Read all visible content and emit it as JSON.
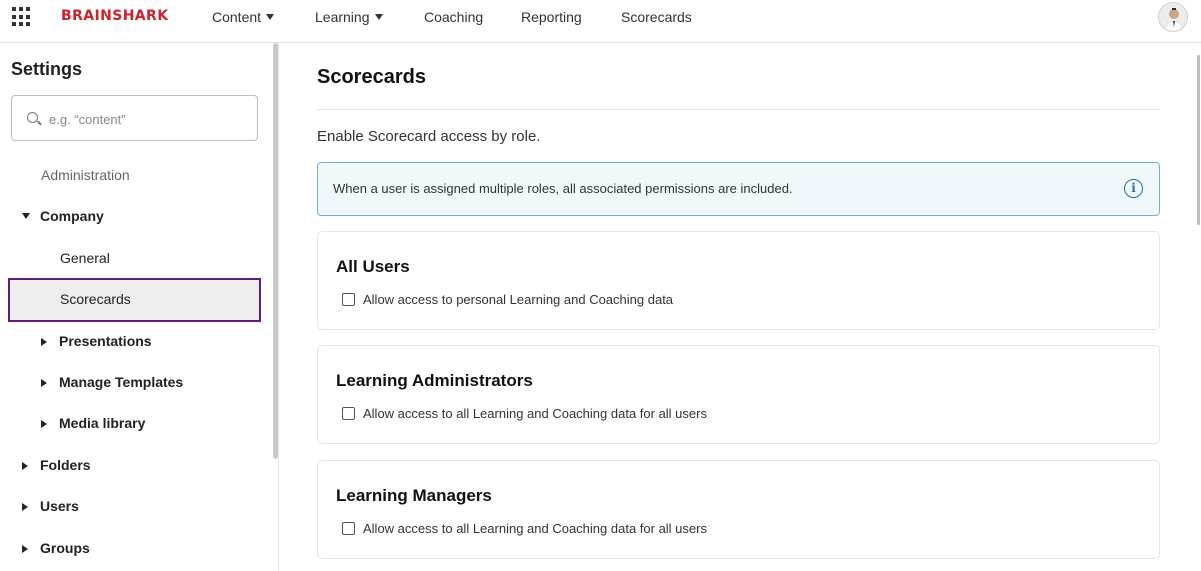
{
  "topbar": {
    "logo": "BRAINSHARK",
    "nav": [
      {
        "label": "Content",
        "dropdown": true
      },
      {
        "label": "Learning",
        "dropdown": true
      },
      {
        "label": "Coaching",
        "dropdown": false
      },
      {
        "label": "Reporting",
        "dropdown": false
      },
      {
        "label": "Scorecards",
        "dropdown": false
      }
    ]
  },
  "sidebar": {
    "title": "Settings",
    "search_placeholder": "e.g. “content”",
    "items": {
      "administration": "Administration",
      "company": "Company",
      "general": "General",
      "scorecards": "Scorecards",
      "presentations": "Presentations",
      "manage_templates": "Manage Templates",
      "media_library": "Media library",
      "folders": "Folders",
      "users": "Users",
      "groups": "Groups"
    }
  },
  "main": {
    "title": "Scorecards",
    "subtitle": "Enable Scorecard access by role.",
    "info": "When a user is assigned multiple roles, all associated permissions are included.",
    "cards": [
      {
        "title": "All Users",
        "option": "Allow access to personal Learning and Coaching data"
      },
      {
        "title": "Learning Administrators",
        "option": "Allow access to all Learning and Coaching data for all users"
      },
      {
        "title": "Learning Managers",
        "option": "Allow access to all Learning and Coaching data for all users"
      }
    ]
  },
  "colors": {
    "brand": "#d0202e",
    "selected_outline": "#5e1d7a",
    "info_border": "#6fb3d2",
    "info_icon": "#1f6fb2"
  }
}
